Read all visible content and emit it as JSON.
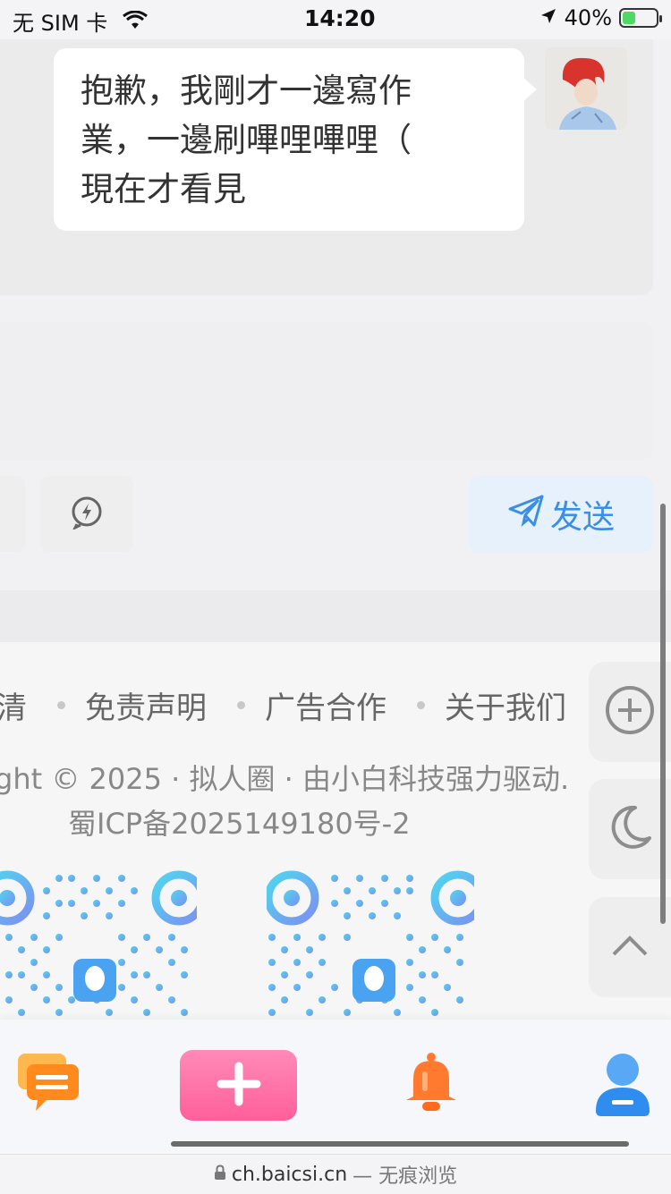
{
  "status_bar": {
    "carrier": "无 SIM 卡",
    "time": "14:20",
    "battery": "40%",
    "battery_level": 0.4
  },
  "chat": {
    "message_lines": [
      "抱歉，我剛才一邊寫作",
      "業，一邊刷嗶哩嗶哩（",
      "現在才看見"
    ]
  },
  "composer": {
    "send_label": "发送"
  },
  "footer": {
    "links": [
      "清",
      "免责声明",
      "广告合作",
      "关于我们"
    ],
    "copyright": "ght © 2025 · 拟人圈 · 由小白科技强力驱动.",
    "icp": "蜀ICP备2025149180号-2"
  },
  "url_bar": {
    "domain": "ch.baicsi.cn",
    "suffix": "— 无痕浏览"
  },
  "colors": {
    "accent_blue": "#3a8ee6",
    "add_pink": "#ff6fa6",
    "bell_orange": "#ff7a2e",
    "user_blue": "#2f8df0",
    "msg_orange": "#ff9a1e"
  }
}
